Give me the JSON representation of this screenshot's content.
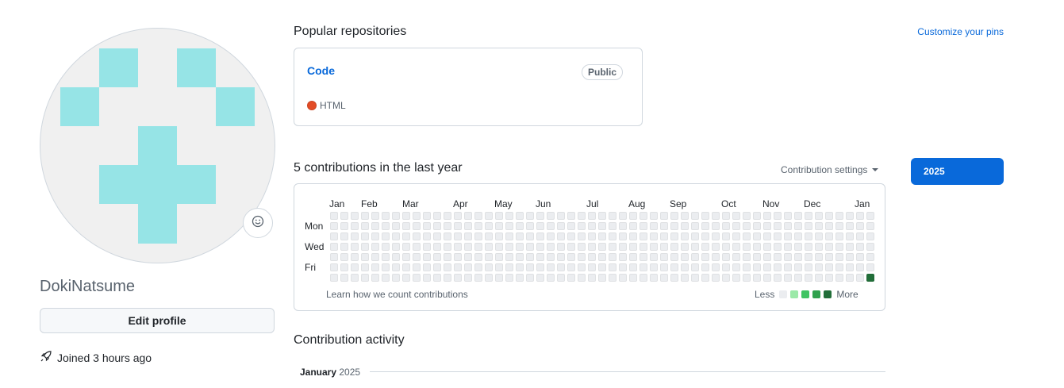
{
  "profile": {
    "username": "DokiNatsume",
    "edit_label": "Edit profile",
    "joined": "Joined 3 hours ago",
    "identicon_color": "#96e4e6"
  },
  "pinned": {
    "title": "Popular repositories",
    "customize_label": "Customize your pins",
    "repo": {
      "name": "Code",
      "visibility": "Public",
      "language": "HTML",
      "language_color": "#e34c26"
    }
  },
  "contributions": {
    "title": "5 contributions in the last year",
    "settings_label": "Contribution settings",
    "year_button": "2025",
    "months": [
      "Jan",
      "Feb",
      "Mar",
      "Apr",
      "May",
      "Jun",
      "Jul",
      "Aug",
      "Sep",
      "Oct",
      "Nov",
      "Dec",
      "Jan"
    ],
    "days": [
      "Mon",
      "Wed",
      "Fri"
    ],
    "learn_label": "Learn how we count contributions",
    "legend_less": "Less",
    "legend_more": "More",
    "legend_colors": [
      "#ebedf0",
      "#9be9a8",
      "#40c463",
      "#30a14e",
      "#216e39"
    ],
    "active_cell": {
      "week": 52,
      "day": "Sat",
      "level": 4
    }
  },
  "activity": {
    "title": "Contribution activity",
    "month": "January",
    "year": "2025"
  }
}
